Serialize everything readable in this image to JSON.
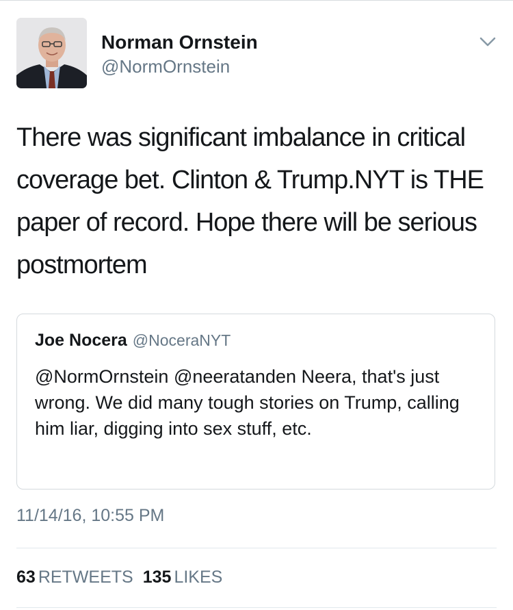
{
  "tweet": {
    "author": {
      "name": "Norman Ornstein",
      "handle": "@NormOrnstein"
    },
    "text": "There was significant imbalance in critical coverage bet. Clinton & Trump.NYT is THE paper of record. Hope there will be serious postmortem",
    "quoted_tweet": {
      "author_name": "Joe Nocera",
      "author_handle": "@NoceraNYT",
      "text": "@NormOrnstein @neeratanden Neera, that's just wrong.  We did many tough stories on Trump, calling him liar, digging into sex stuff, etc."
    },
    "timestamp": "11/14/16, 10:55 PM",
    "stats": {
      "retweets_count": "63",
      "retweets_label": "RETWEETS",
      "likes_count": "135",
      "likes_label": "LIKES"
    }
  },
  "icons": {
    "menu": "chevron-down-icon",
    "avatar": "avatar"
  },
  "colors": {
    "text_primary": "#14171a",
    "text_secondary": "#657786",
    "border": "#d4d9dd"
  }
}
